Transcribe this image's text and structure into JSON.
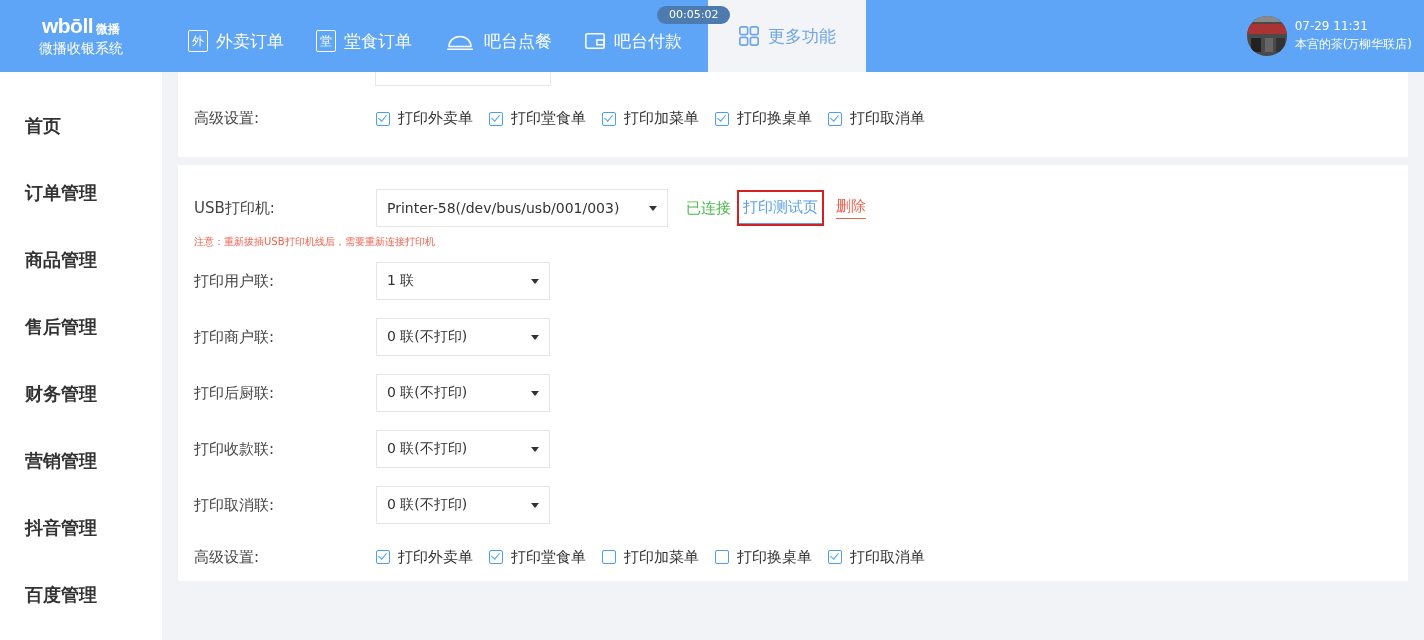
{
  "header": {
    "logo": {
      "brand": "wbōll",
      "brand_cn": "微播",
      "subtitle": "微播收银系统"
    },
    "nav": [
      {
        "label": "外卖订单",
        "kind": "badge",
        "icon_char": "外",
        "selected": false
      },
      {
        "label": "堂食订单",
        "kind": "badge",
        "icon_char": "堂",
        "selected": false
      },
      {
        "label": "吧台点餐",
        "kind": "cloche",
        "selected": false
      },
      {
        "label": "吧台付款",
        "kind": "wallet",
        "selected": false
      },
      {
        "label": "更多功能",
        "kind": "grid",
        "selected": true
      }
    ],
    "timer": "00:05:02",
    "user": {
      "datetime": "07-29 11:31",
      "store": "本宫的茶(万柳华联店)"
    }
  },
  "sidebar": {
    "items": [
      {
        "label": "首页"
      },
      {
        "label": "订单管理"
      },
      {
        "label": "商品管理"
      },
      {
        "label": "售后管理"
      },
      {
        "label": "财务管理"
      },
      {
        "label": "营销管理"
      },
      {
        "label": "抖音管理"
      },
      {
        "label": "百度管理"
      }
    ]
  },
  "top_card": {
    "advanced": {
      "label": "高级设置:",
      "options": [
        {
          "label": "打印外卖单",
          "checked": true
        },
        {
          "label": "打印堂食单",
          "checked": true
        },
        {
          "label": "打印加菜单",
          "checked": true
        },
        {
          "label": "打印换桌单",
          "checked": true
        },
        {
          "label": "打印取消单",
          "checked": true
        }
      ]
    }
  },
  "printer_card": {
    "usb": {
      "label": "USB打印机:",
      "value": "Printer-58(/dev/bus/usb/001/003)",
      "status": "已连接",
      "test_link": "打印测试页",
      "highlighted": true,
      "delete_link": "删除"
    },
    "note": "注意：重新拔插USB打印机线后，需要重新连接打印机",
    "copies": [
      {
        "label": "打印用户联:",
        "value": "1 联"
      },
      {
        "label": "打印商户联:",
        "value": "0 联(不打印)"
      },
      {
        "label": "打印后厨联:",
        "value": "0 联(不打印)"
      },
      {
        "label": "打印收款联:",
        "value": "0 联(不打印)"
      },
      {
        "label": "打印取消联:",
        "value": "0 联(不打印)"
      }
    ],
    "advanced": {
      "label": "高级设置:",
      "options": [
        {
          "label": "打印外卖单",
          "checked": true
        },
        {
          "label": "打印堂食单",
          "checked": true
        },
        {
          "label": "打印加菜单",
          "checked": false
        },
        {
          "label": "打印换桌单",
          "checked": false
        },
        {
          "label": "打印取消单",
          "checked": true
        }
      ]
    }
  }
}
